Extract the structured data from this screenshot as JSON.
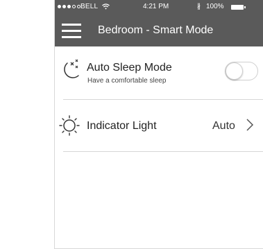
{
  "status_bar": {
    "carrier": "BELL",
    "time": "4:21 PM",
    "bluetooth_glyph": "∦",
    "battery_percent": "100%",
    "battery_level": 1.0
  },
  "nav": {
    "title": "Bedroom - Smart Mode",
    "menu_icon": "hamburger-menu-icon"
  },
  "settings": {
    "auto_sleep": {
      "title": "Auto Sleep Mode",
      "subtitle": "Have a comfortable sleep",
      "icon": "moon-stars-icon",
      "enabled": false
    },
    "indicator_light": {
      "title": "Indicator Light",
      "value": "Auto",
      "icon": "sun-icon"
    }
  },
  "colors": {
    "header": "#5a5a5a",
    "text": "#222222",
    "separator": "#d6d6d6"
  }
}
